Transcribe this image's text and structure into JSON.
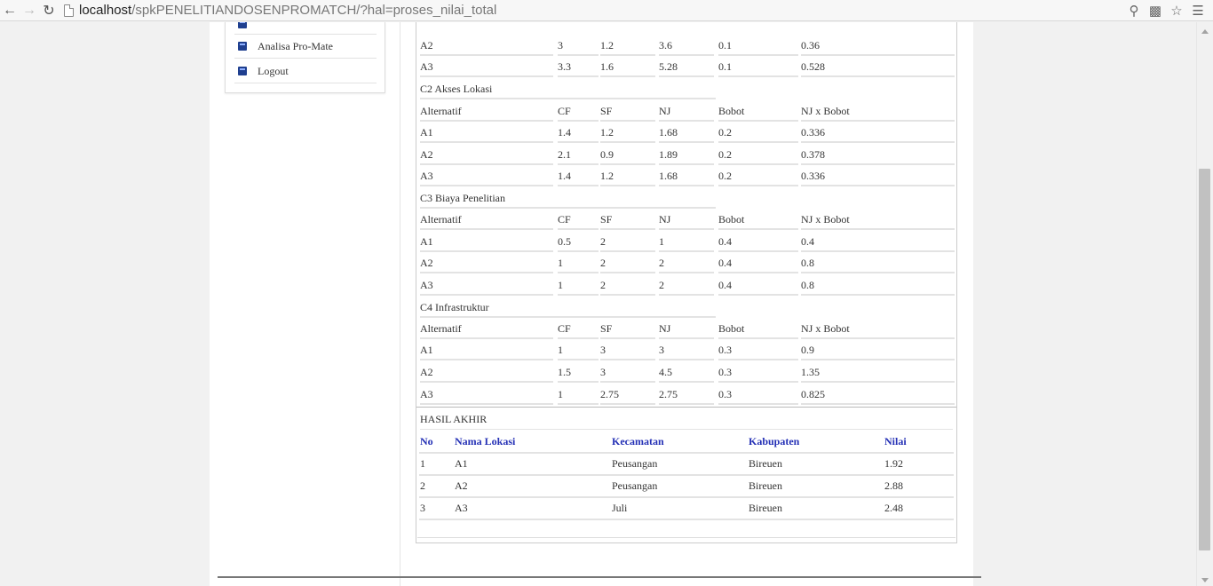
{
  "browser": {
    "url_host": "localhost",
    "url_path": "/spkPENELITIANDOSENPROMATCH/?hal=proses_nilai_total"
  },
  "sidebar": {
    "items": [
      {
        "label": "Analisa Pro-Mate"
      },
      {
        "label": "Logout"
      }
    ]
  },
  "partial_rows": [
    {
      "alt": "A2",
      "cf": "3",
      "sf": "1.2",
      "nj": "3.6",
      "bobot": "0.1",
      "njb": "0.36"
    },
    {
      "alt": "A3",
      "cf": "3.3",
      "sf": "1.6",
      "nj": "5.28",
      "bobot": "0.1",
      "njb": "0.528"
    }
  ],
  "criteria": [
    {
      "title": "C2 Akses Lokasi",
      "headers": {
        "alt": "Alternatif",
        "cf": "CF",
        "sf": "SF",
        "nj": "NJ",
        "bobot": "Bobot",
        "njb": "NJ x Bobot"
      },
      "rows": [
        {
          "alt": "A1",
          "cf": "1.4",
          "sf": "1.2",
          "nj": "1.68",
          "bobot": "0.2",
          "njb": "0.336"
        },
        {
          "alt": "A2",
          "cf": "2.1",
          "sf": "0.9",
          "nj": "1.89",
          "bobot": "0.2",
          "njb": "0.378"
        },
        {
          "alt": "A3",
          "cf": "1.4",
          "sf": "1.2",
          "nj": "1.68",
          "bobot": "0.2",
          "njb": "0.336"
        }
      ]
    },
    {
      "title": "C3 Biaya Penelitian",
      "headers": {
        "alt": "Alternatif",
        "cf": "CF",
        "sf": "SF",
        "nj": "NJ",
        "bobot": "Bobot",
        "njb": "NJ x Bobot"
      },
      "rows": [
        {
          "alt": "A1",
          "cf": "0.5",
          "sf": "2",
          "nj": "1",
          "bobot": "0.4",
          "njb": "0.4"
        },
        {
          "alt": "A2",
          "cf": "1",
          "sf": "2",
          "nj": "2",
          "bobot": "0.4",
          "njb": "0.8"
        },
        {
          "alt": "A3",
          "cf": "1",
          "sf": "2",
          "nj": "2",
          "bobot": "0.4",
          "njb": "0.8"
        }
      ]
    },
    {
      "title": "C4 Infrastruktur",
      "headers": {
        "alt": "Alternatif",
        "cf": "CF",
        "sf": "SF",
        "nj": "NJ",
        "bobot": "Bobot",
        "njb": "NJ x Bobot"
      },
      "rows": [
        {
          "alt": "A1",
          "cf": "1",
          "sf": "3",
          "nj": "3",
          "bobot": "0.3",
          "njb": "0.9"
        },
        {
          "alt": "A2",
          "cf": "1.5",
          "sf": "3",
          "nj": "4.5",
          "bobot": "0.3",
          "njb": "1.35"
        },
        {
          "alt": "A3",
          "cf": "1",
          "sf": "2.75",
          "nj": "2.75",
          "bobot": "0.3",
          "njb": "0.825"
        }
      ]
    }
  ],
  "hasil": {
    "title": "HASIL AKHIR",
    "headers": {
      "no": "No",
      "nama": "Nama Lokasi",
      "kec": "Kecamatan",
      "kab": "Kabupaten",
      "nilai": "Nilai"
    },
    "rows": [
      {
        "no": "1",
        "nama": "A1",
        "kec": "Peusangan",
        "kab": "Bireuen",
        "nilai": "1.92"
      },
      {
        "no": "2",
        "nama": "A2",
        "kec": "Peusangan",
        "kab": "Bireuen",
        "nilai": "2.88"
      },
      {
        "no": "3",
        "nama": "A3",
        "kec": "Juli",
        "kab": "Bireuen",
        "nilai": "2.48"
      }
    ]
  }
}
